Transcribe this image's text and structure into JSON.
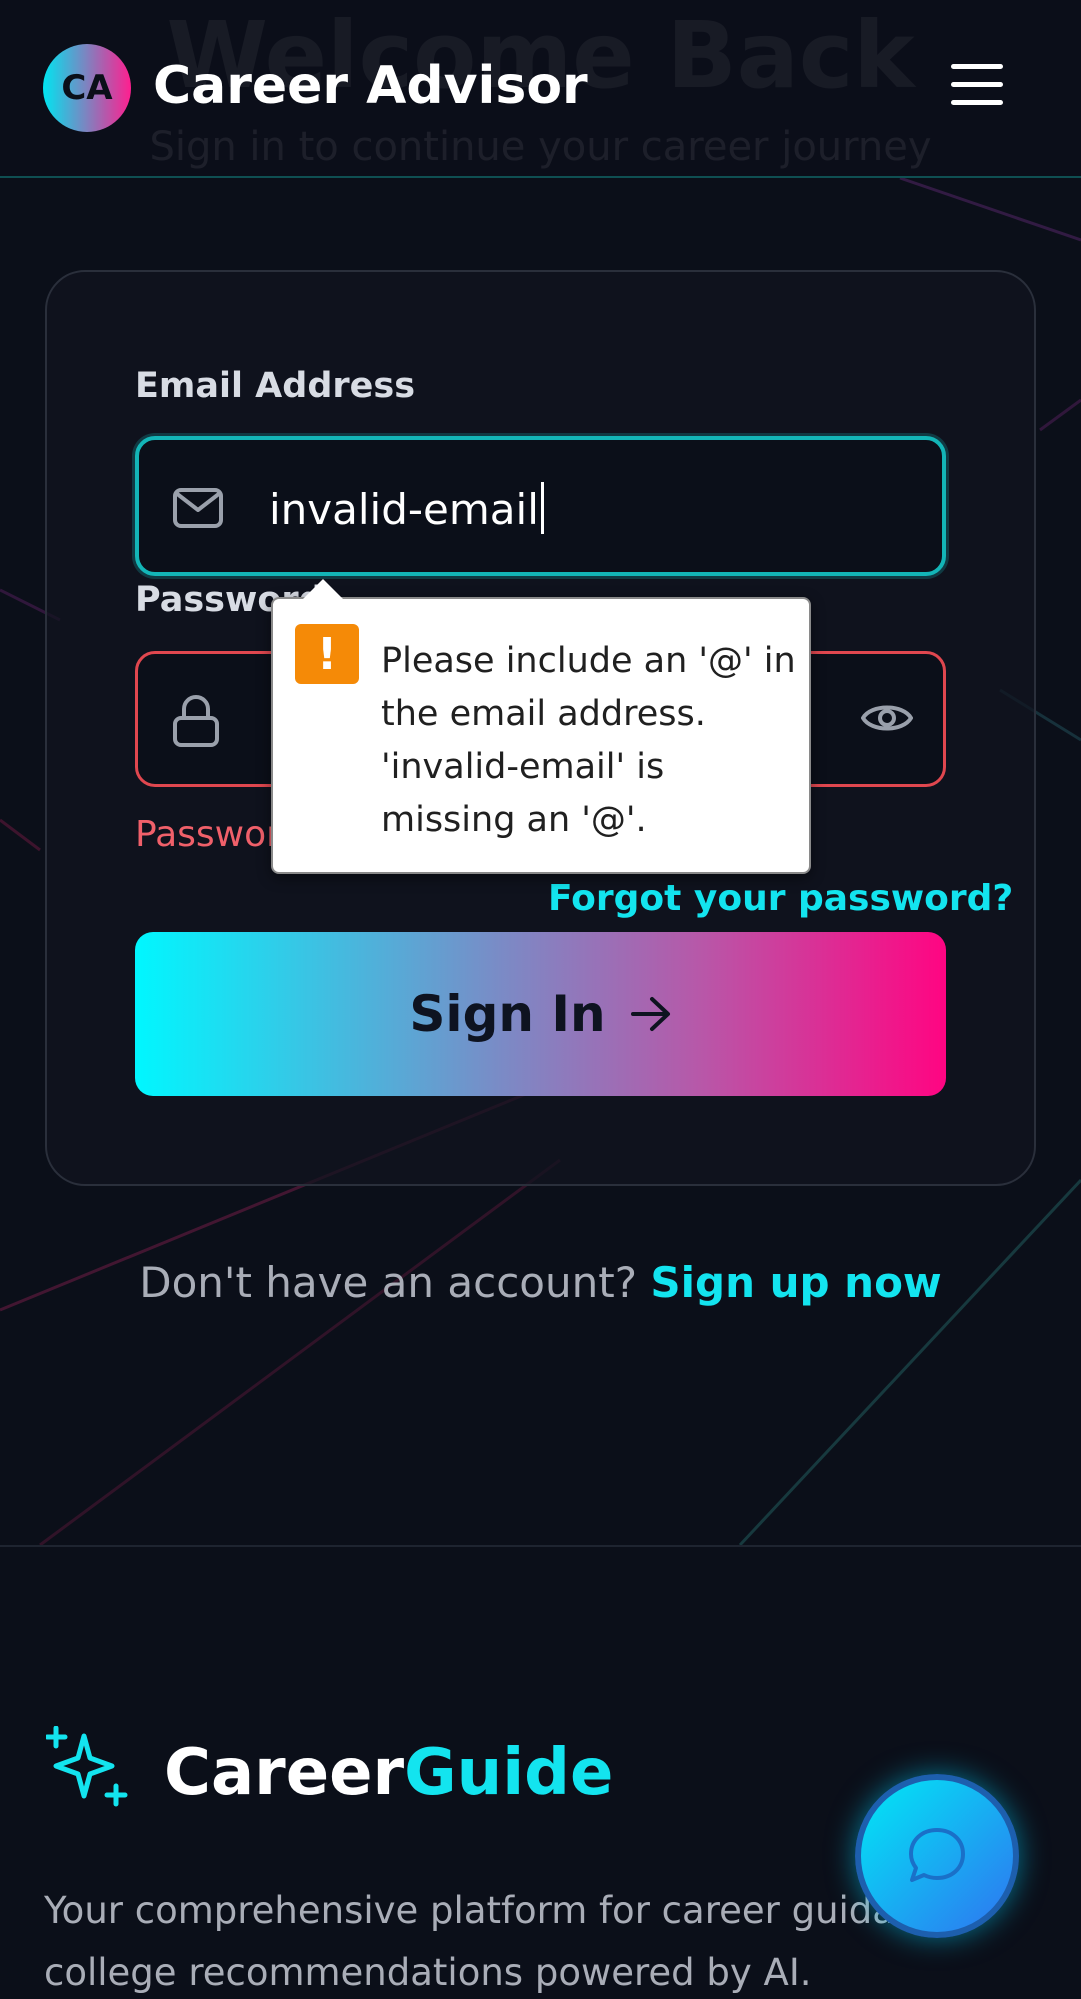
{
  "header": {
    "logo_initials": "CA",
    "brand": "Career Advisor",
    "ghost_title": "Welcome Back",
    "ghost_subtitle": "Sign in to continue your career journey"
  },
  "form": {
    "email_label": "Email Address",
    "email_value": "invalid-email",
    "password_label": "Password",
    "password_error": "Password",
    "forgot_link": "Forgot your password?",
    "signin_label": "Sign In"
  },
  "tooltip": {
    "message": "Please include an '@' in the email address. 'invalid-email' is missing an '@'."
  },
  "signup": {
    "prompt": "Don't have an account? ",
    "link": "Sign up now"
  },
  "footer": {
    "brand_main": "Career",
    "brand_accent": "Guide",
    "description": "Your comprehensive platform for career guidance college recommendations powered by AI."
  },
  "colors": {
    "accent_cyan": "#13e4ef",
    "accent_pink": "#ff0582",
    "error_red": "#e0474f",
    "warning_orange": "#f58a07",
    "background": "#0b0f19"
  },
  "icons": [
    "menu-icon",
    "mail-icon",
    "lock-icon",
    "eye-icon",
    "warning-icon",
    "arrow-right-icon",
    "sparkle-icon",
    "chat-icon"
  ]
}
